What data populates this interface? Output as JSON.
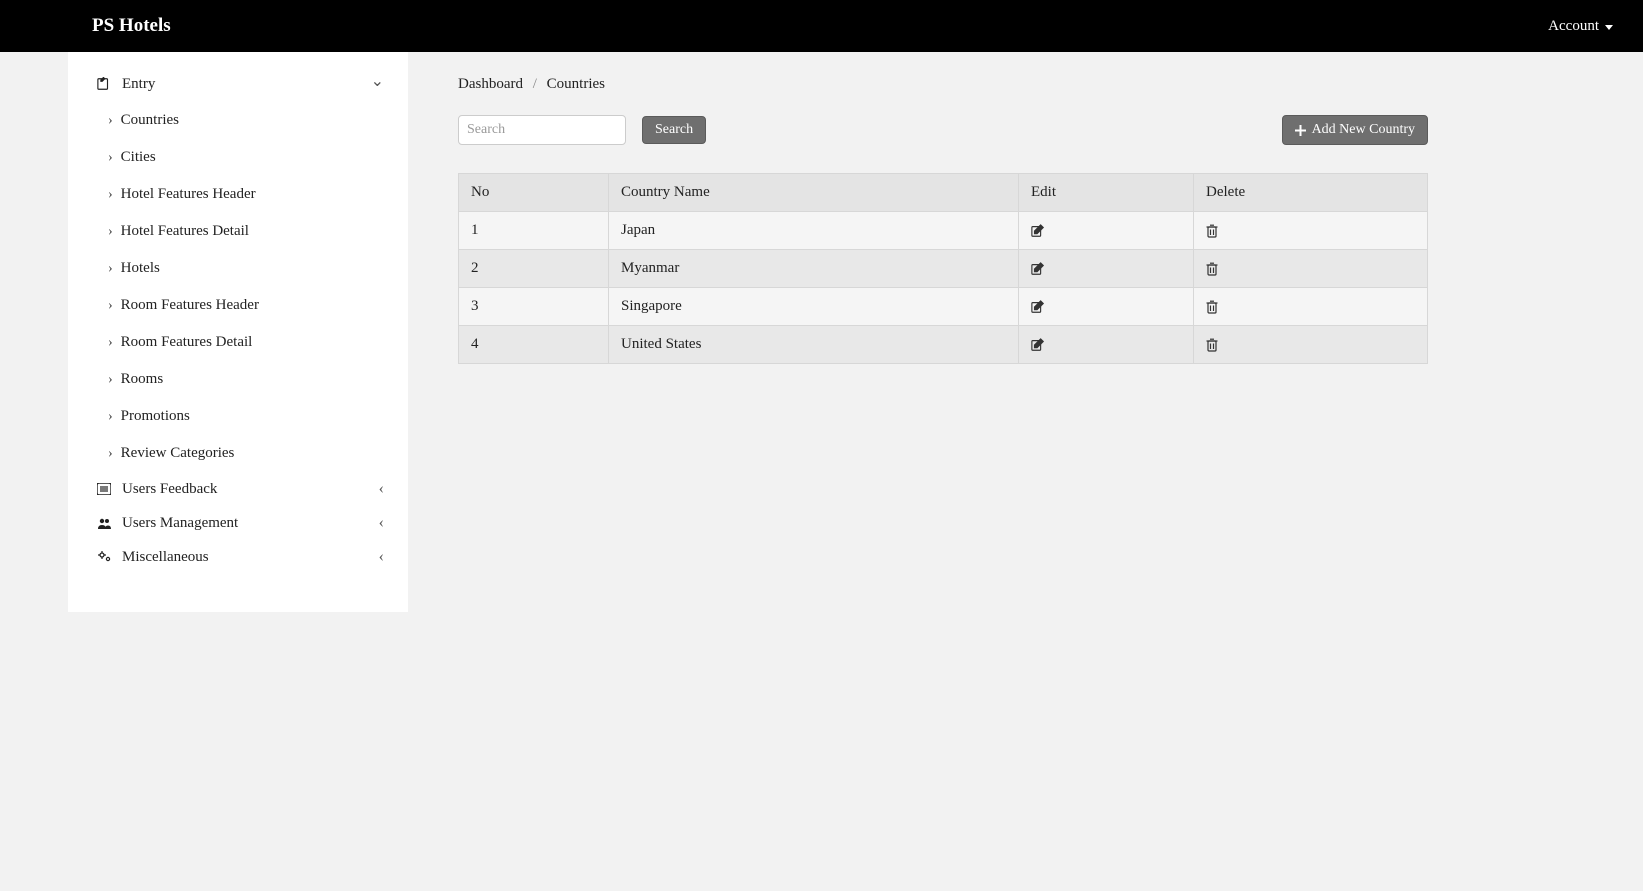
{
  "navbar": {
    "brand": "PS Hotels",
    "account_label": "Account"
  },
  "sidebar": {
    "entry_label": "Entry",
    "entry_items": [
      "Countries",
      "Cities",
      "Hotel Features Header",
      "Hotel Features Detail",
      "Hotels",
      "Room Features Header",
      "Room Features Detail",
      "Rooms",
      "Promotions",
      "Review Categories"
    ],
    "users_feedback_label": "Users Feedback",
    "users_management_label": "Users Management",
    "miscellaneous_label": "Miscellaneous"
  },
  "breadcrumb": {
    "dashboard": "Dashboard",
    "current": "Countries"
  },
  "toolbar": {
    "search_placeholder": "Search",
    "search_button": "Search",
    "add_button": "Add New Country"
  },
  "table": {
    "headers": {
      "no": "No",
      "name": "Country Name",
      "edit": "Edit",
      "delete": "Delete"
    },
    "rows": [
      {
        "no": "1",
        "name": "Japan"
      },
      {
        "no": "2",
        "name": "Myanmar"
      },
      {
        "no": "3",
        "name": "Singapore"
      },
      {
        "no": "4",
        "name": "United States"
      }
    ]
  }
}
